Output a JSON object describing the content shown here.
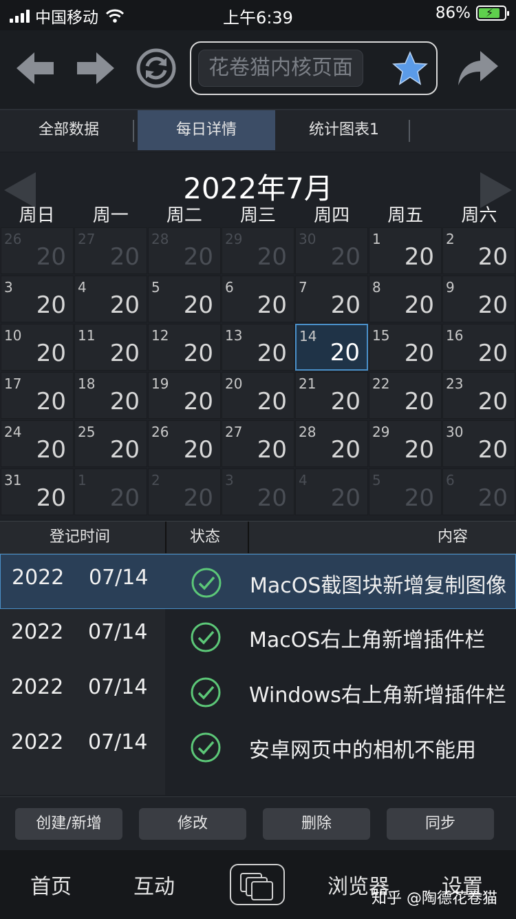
{
  "status": {
    "carrier": "中国移动",
    "time": "上午6:39",
    "battery": "86%",
    "battery_fraction": 0.86
  },
  "toolbar": {
    "url_text": "花卷猫内核页面",
    "icons": [
      "back-arrow-icon",
      "forward-arrow-icon",
      "refresh-icon",
      "star-icon",
      "share-icon"
    ]
  },
  "tabs": [
    "全部数据",
    "每日详情",
    "统计图表1"
  ],
  "calendar": {
    "month": "2022年7月",
    "weekdays": [
      "周日",
      "周一",
      "周二",
      "周三",
      "周四",
      "周五",
      "周六"
    ],
    "cells": [
      {
        "d": "26",
        "v": "20",
        "dim": true
      },
      {
        "d": "27",
        "v": "20",
        "dim": true
      },
      {
        "d": "28",
        "v": "20",
        "dim": true
      },
      {
        "d": "29",
        "v": "20",
        "dim": true
      },
      {
        "d": "30",
        "v": "20",
        "dim": true
      },
      {
        "d": "1",
        "v": "20"
      },
      {
        "d": "2",
        "v": "20"
      },
      {
        "d": "3",
        "v": "20"
      },
      {
        "d": "4",
        "v": "20"
      },
      {
        "d": "5",
        "v": "20"
      },
      {
        "d": "6",
        "v": "20"
      },
      {
        "d": "7",
        "v": "20"
      },
      {
        "d": "8",
        "v": "20"
      },
      {
        "d": "9",
        "v": "20"
      },
      {
        "d": "10",
        "v": "20"
      },
      {
        "d": "11",
        "v": "20"
      },
      {
        "d": "12",
        "v": "20"
      },
      {
        "d": "13",
        "v": "20"
      },
      {
        "d": "14",
        "v": "20",
        "sel": true
      },
      {
        "d": "15",
        "v": "20"
      },
      {
        "d": "16",
        "v": "20"
      },
      {
        "d": "17",
        "v": "20"
      },
      {
        "d": "18",
        "v": "20"
      },
      {
        "d": "19",
        "v": "20"
      },
      {
        "d": "20",
        "v": "20"
      },
      {
        "d": "21",
        "v": "20"
      },
      {
        "d": "22",
        "v": "20"
      },
      {
        "d": "23",
        "v": "20"
      },
      {
        "d": "24",
        "v": "20"
      },
      {
        "d": "25",
        "v": "20"
      },
      {
        "d": "26",
        "v": "20"
      },
      {
        "d": "27",
        "v": "20"
      },
      {
        "d": "28",
        "v": "20"
      },
      {
        "d": "29",
        "v": "20"
      },
      {
        "d": "30",
        "v": "20"
      },
      {
        "d": "31",
        "v": "20"
      },
      {
        "d": "1",
        "v": "20",
        "dim": true
      },
      {
        "d": "2",
        "v": "20",
        "dim": true
      },
      {
        "d": "3",
        "v": "20",
        "dim": true
      },
      {
        "d": "4",
        "v": "20",
        "dim": true
      },
      {
        "d": "5",
        "v": "20",
        "dim": true
      },
      {
        "d": "6",
        "v": "20",
        "dim": true
      }
    ]
  },
  "list": {
    "headers": [
      "登记时间",
      "状态",
      "内容"
    ],
    "rows": [
      {
        "year": "2022",
        "date": "07/14",
        "text": "MacOS截图块新增复制图像",
        "selected": true
      },
      {
        "year": "2022",
        "date": "07/14",
        "text": "MacOS右上角新增插件栏"
      },
      {
        "year": "2022",
        "date": "07/14",
        "text": "Windows右上角新增插件栏"
      },
      {
        "year": "2022",
        "date": "07/14",
        "text": "安卓网页中的相机不能用"
      }
    ]
  },
  "actions": [
    "创建/新增",
    "修改",
    "删除",
    "同步"
  ],
  "bottom_nav": {
    "items": [
      "首页",
      "互动",
      "浏览器",
      "设置"
    ],
    "watermark": "知乎 @陶德花卷猫"
  },
  "colors": {
    "accent": "#4a90c9",
    "active_tab": "#3c4d66",
    "check": "#5cc878",
    "star": "#5b9be8"
  }
}
